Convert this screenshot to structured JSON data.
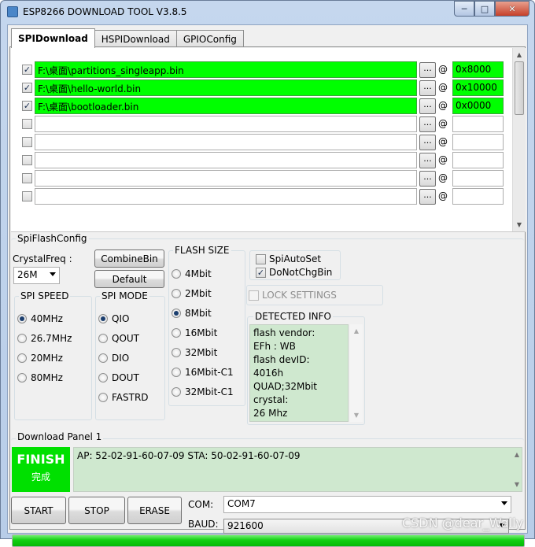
{
  "window": {
    "title": "ESP8266 DOWNLOAD TOOL V3.8.5"
  },
  "tabs": [
    "SPIDownload",
    "HSPIDownload",
    "GPIOConfig"
  ],
  "files": [
    {
      "checked": true,
      "path": "F:\\桌面\\partitions_singleapp.bin",
      "address": "0x8000",
      "highlight": true
    },
    {
      "checked": true,
      "path": "F:\\桌面\\hello-world.bin",
      "address": "0x10000",
      "highlight": true
    },
    {
      "checked": true,
      "path": "F:\\桌面\\bootloader.bin",
      "address": "0x0000",
      "highlight": true
    },
    {
      "checked": false,
      "path": "",
      "address": "",
      "highlight": false
    },
    {
      "checked": false,
      "path": "",
      "address": "",
      "highlight": false
    },
    {
      "checked": false,
      "path": "",
      "address": "",
      "highlight": false
    },
    {
      "checked": false,
      "path": "",
      "address": "",
      "highlight": false
    },
    {
      "checked": false,
      "path": "",
      "address": "",
      "highlight": false
    }
  ],
  "file_ui": {
    "browse_label": "...",
    "at_label": "@",
    "checkmark": "✓"
  },
  "spi_flash_config": {
    "label": "SpiFlashConfig",
    "crystal_label": "CrystalFreq :",
    "crystal_value": "26M",
    "combine_button": "CombineBin",
    "default_button": "Default",
    "spi_speed": {
      "label": "SPI SPEED",
      "options": [
        "40MHz",
        "26.7MHz",
        "20MHz",
        "80MHz"
      ],
      "selected": "40MHz"
    },
    "spi_mode": {
      "label": "SPI MODE",
      "options": [
        "QIO",
        "QOUT",
        "DIO",
        "DOUT",
        "FASTRD"
      ],
      "selected": "QIO"
    },
    "flash_size": {
      "label": "FLASH SIZE",
      "options": [
        "4Mbit",
        "2Mbit",
        "8Mbit",
        "16Mbit",
        "32Mbit",
        "16Mbit-C1",
        "32Mbit-C1"
      ],
      "selected": "8Mbit"
    },
    "spi_auto_set": {
      "label": "SpiAutoSet",
      "checked": false
    },
    "do_not_chg_bin": {
      "label": "DoNotChgBin",
      "checked": true
    },
    "lock_settings": {
      "label": "LOCK SETTINGS",
      "checked": false
    },
    "detected_info": {
      "label": "DETECTED INFO",
      "lines": [
        "flash vendor:",
        "EFh : WB",
        "flash devID:",
        "4016h",
        "QUAD;32Mbit",
        "crystal:",
        "26 Mhz"
      ]
    }
  },
  "download_panel": {
    "label": "Download Panel 1",
    "status": "FINISH",
    "status_sub": "完成",
    "log": "AP:  52-02-91-60-07-09  STA:  50-02-91-60-07-09",
    "progress_percent": 100
  },
  "buttons": {
    "start": "START",
    "stop": "STOP",
    "erase": "ERASE"
  },
  "com": {
    "label": "COM:",
    "value": "COM7"
  },
  "baud": {
    "label": "BAUD:",
    "value": "921600"
  },
  "watermark": "CSDN @dear_Wally",
  "colors": {
    "highlight": "#00ff00",
    "finish": "#00e000",
    "info_bg": "#cfe8cf"
  }
}
